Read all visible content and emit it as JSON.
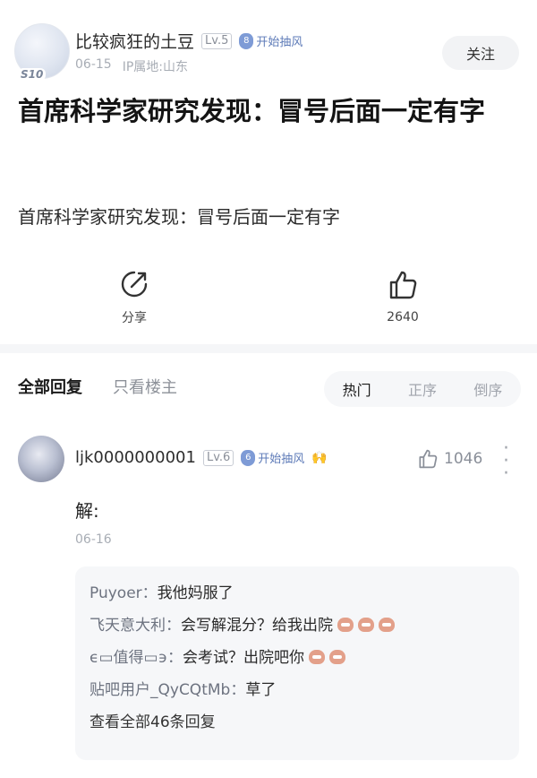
{
  "post": {
    "author": {
      "name": "比较疯狂的土豆",
      "level": "Lv.5",
      "tag": "开始抽风",
      "tag_badge": "8",
      "avatar_badge": "S10"
    },
    "date": "06-15",
    "ip_location": "IP属地:山东",
    "follow_label": "关注",
    "title": "首席科学家研究发现：冒号后面一定有字",
    "body": "首席科学家研究发现：冒号后面一定有字"
  },
  "actions": {
    "share_label": "分享",
    "like_count": "2640"
  },
  "reply_tabs": [
    "全部回复",
    "只看楼主"
  ],
  "sort_tabs": [
    "热门",
    "正序",
    "倒序"
  ],
  "comment": {
    "author": "ljk0000000001",
    "level": "Lv.6",
    "tag": "开始抽风",
    "tag_badge": "6",
    "emoji": "🙌",
    "likes": "1046",
    "text": "解:",
    "date": "06-16"
  },
  "sub_replies": [
    {
      "name": "Puyoer",
      "text": "我他妈服了",
      "emoji_count": 0
    },
    {
      "name": "飞天意大利",
      "text": "会写解混分？给我出院",
      "emoji_count": 3
    },
    {
      "name": "ϵ▭值得▭϶",
      "text": "会考试？出院吧你",
      "emoji_count": 2
    },
    {
      "name": "贴吧用户_QyCQtMb",
      "text": "草了",
      "emoji_count": 0
    }
  ],
  "view_all_label": "查看全部46条回复",
  "colors": {
    "tag_blue": "#7e9bd6",
    "muted_text": "#a8adb5",
    "panel_bg": "#f6f7f9"
  }
}
